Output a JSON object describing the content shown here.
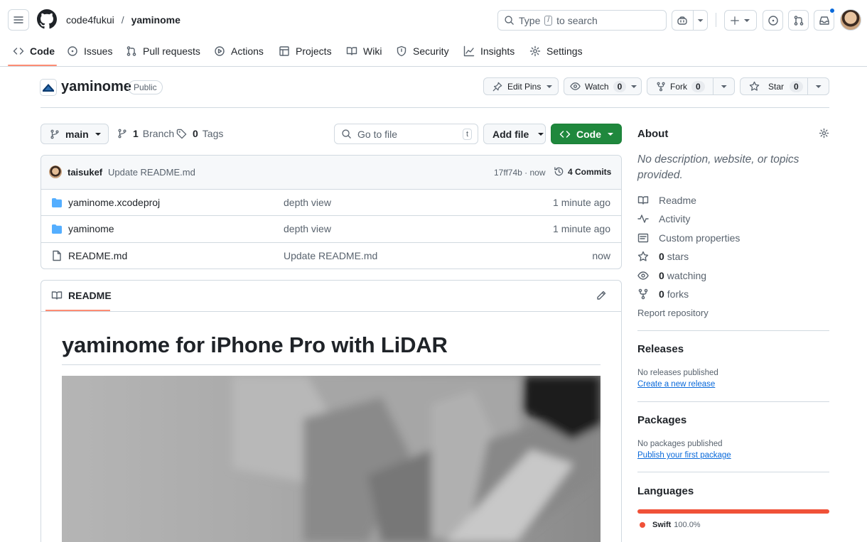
{
  "header": {
    "owner": "code4fukui",
    "slash": "/",
    "repo": "yaminome",
    "search_before": "Type",
    "search_key": "/",
    "search_after": "to search"
  },
  "nav": {
    "tabs": [
      {
        "label": "Code",
        "icon": "code-icon"
      },
      {
        "label": "Issues",
        "icon": "issue-icon"
      },
      {
        "label": "Pull requests",
        "icon": "pull-request-icon"
      },
      {
        "label": "Actions",
        "icon": "play-icon"
      },
      {
        "label": "Projects",
        "icon": "table-icon"
      },
      {
        "label": "Wiki",
        "icon": "book-icon"
      },
      {
        "label": "Security",
        "icon": "shield-icon"
      },
      {
        "label": "Insights",
        "icon": "graph-icon"
      },
      {
        "label": "Settings",
        "icon": "gear-icon"
      }
    ]
  },
  "repo_header": {
    "name": "yaminome",
    "visibility": "Public",
    "edit_pins": "Edit Pins",
    "watch": "Watch",
    "watch_count": "0",
    "fork": "Fork",
    "fork_count": "0",
    "star": "Star",
    "star_count": "0"
  },
  "toolbar": {
    "branch": "main",
    "branch_count": "1",
    "branch_label": "Branch",
    "tag_count": "0",
    "tag_label": "Tags",
    "goto_placeholder": "Go to file",
    "goto_key": "t",
    "add_file": "Add file",
    "code": "Code"
  },
  "commit": {
    "author": "taisukef",
    "message": "Update README.md",
    "hash_time": "17ff74b · now",
    "commits": "4 Commits"
  },
  "files": [
    {
      "name": "yaminome.xcodeproj",
      "type": "folder",
      "message": "depth view",
      "time": "1 minute ago"
    },
    {
      "name": "yaminome",
      "type": "folder",
      "message": "depth view",
      "time": "1 minute ago"
    },
    {
      "name": "README.md",
      "type": "file",
      "message": "Update README.md",
      "time": "now"
    }
  ],
  "readme": {
    "tab": "README",
    "title": "yaminome for iPhone Pro with LiDAR"
  },
  "about": {
    "title": "About",
    "description": "No description, website, or topics provided.",
    "links": [
      {
        "label": "Readme",
        "icon": "book-icon"
      },
      {
        "label": "Activity",
        "icon": "pulse-icon"
      },
      {
        "label": "Custom properties",
        "icon": "note-icon"
      }
    ],
    "stars_count": "0",
    "stars_label": "stars",
    "watching_count": "0",
    "watching_label": "watching",
    "forks_count": "0",
    "forks_label": "forks",
    "report": "Report repository"
  },
  "releases": {
    "title": "Releases",
    "none": "No releases published",
    "create": "Create a new release"
  },
  "packages": {
    "title": "Packages",
    "none": "No packages published",
    "publish": "Publish your first package"
  },
  "languages": {
    "title": "Languages",
    "items": [
      {
        "name": "Swift",
        "percent": "100.0%",
        "color": "#F05138"
      }
    ]
  }
}
